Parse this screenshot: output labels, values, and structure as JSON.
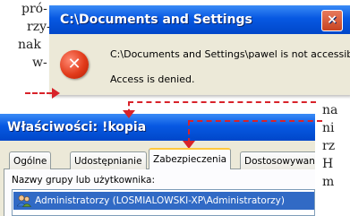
{
  "article": {
    "left_lines": [
      "pró-",
      "rzy-",
      "nak",
      "w-"
    ],
    "right_lines": [
      "na",
      "ni",
      "rz",
      "H",
      "m"
    ]
  },
  "error_dialog": {
    "title": "C:\\Documents and Settings",
    "message": "C:\\Documents and Settings\\pawel is not accessible.",
    "detail": "Access is denied.",
    "close_glyph": "×",
    "icon_glyph": "✕"
  },
  "properties_dialog": {
    "title": "Właściwości: !kopia",
    "tabs": [
      {
        "label": "Ogólne"
      },
      {
        "label": "Udostępnianie"
      },
      {
        "label": "Zabezpieczenia"
      },
      {
        "label": "Dostosowywanie"
      }
    ],
    "active_tab": "Zabezpieczenia",
    "group_label": "Nazwy grupy lub użytkownika:",
    "groups": [
      {
        "name": "Administratorzy (LOSMIALOWSKI-XP\\Administratorzy)",
        "selected": true
      }
    ]
  },
  "colors": {
    "callout": "#d8232a",
    "titlebar": "#0758e2",
    "selection": "#316ac5"
  }
}
